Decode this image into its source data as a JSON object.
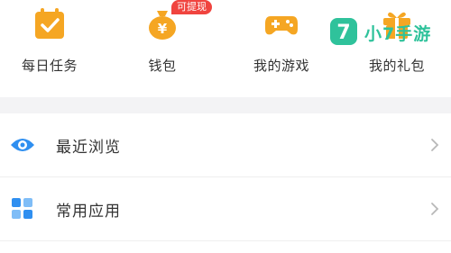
{
  "quick_actions": [
    {
      "label": "每日任务",
      "icon": "task-calendar-icon"
    },
    {
      "label": "钱包",
      "icon": "money-bag-icon",
      "badge": "可提现"
    },
    {
      "label": "我的游戏",
      "icon": "gamepad-icon"
    },
    {
      "label": "我的礼包",
      "icon": "gift-icon"
    }
  ],
  "watermark": {
    "text": "小7手游",
    "logo_glyph": "7"
  },
  "menu": [
    {
      "label": "最近浏览",
      "icon": "eye-icon"
    },
    {
      "label": "常用应用",
      "icon": "apps-grid-icon"
    }
  ],
  "colors": {
    "accent_orange": "#f5a623",
    "accent_blue": "#2f8ff0",
    "badge_red": "#f0443f",
    "watermark_green": "#2fc29b"
  }
}
